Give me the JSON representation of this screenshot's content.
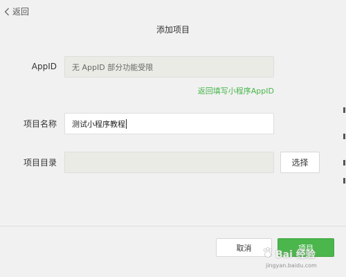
{
  "header": {
    "back_label": "返回",
    "title": "添加项目"
  },
  "form": {
    "appid": {
      "label": "AppID",
      "value": "无 AppID 部分功能受限",
      "link": "返回填写小程序AppID"
    },
    "project_name": {
      "label": "项目名称",
      "value": "测试小程序教程"
    },
    "project_dir": {
      "label": "项目目录",
      "value": "",
      "choose_label": "选择"
    }
  },
  "footer": {
    "cancel_label": "取消",
    "add_label": "项目"
  },
  "watermark": {
    "text": "Bai 经验",
    "url": "jingyan.baidu.com"
  },
  "colors": {
    "accent_green": "#4ab64c",
    "link_green": "#46b54a",
    "background": "#f1f1f1"
  }
}
